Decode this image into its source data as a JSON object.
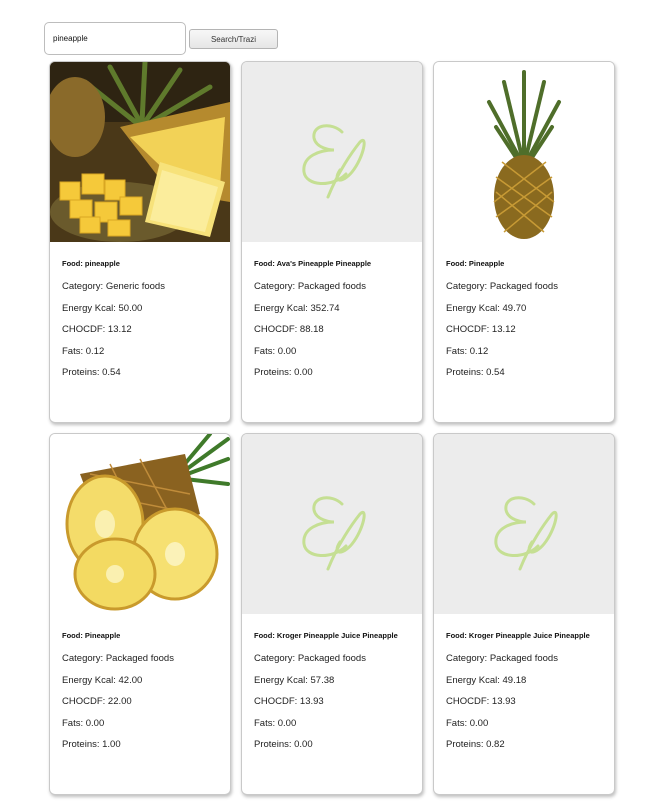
{
  "search": {
    "value": "pineapple",
    "button_label": "Search/Trazi"
  },
  "cards": [
    {
      "food": "Food: pineapple",
      "category": "Category: Generic foods",
      "energy": "Energy Kcal: 50.00",
      "chocdf": "CHOCDF: 13.12",
      "fats": "Fats: 0.12",
      "proteins": "Proteins: 0.54",
      "image": "pineapple-chunks-photo"
    },
    {
      "food": "Food: Ava's Pineapple Pineapple",
      "category": "Category: Packaged foods",
      "energy": "Energy Kcal: 352.74",
      "chocdf": "CHOCDF: 88.18",
      "fats": "Fats: 0.00",
      "proteins": "Proteins: 0.00",
      "image": "placeholder-logo"
    },
    {
      "food": "Food: Pineapple",
      "category": "Category: Packaged foods",
      "energy": "Energy Kcal: 49.70",
      "chocdf": "CHOCDF: 13.12",
      "fats": "Fats: 0.12",
      "proteins": "Proteins: 0.54",
      "image": "whole-pineapple-photo"
    },
    {
      "food": "Food: Pineapple",
      "category": "Category: Packaged foods",
      "energy": "Energy Kcal: 42.00",
      "chocdf": "CHOCDF: 22.00",
      "fats": "Fats: 0.00",
      "proteins": "Proteins: 1.00",
      "image": "pineapple-slices-photo"
    },
    {
      "food": "Food: Kroger Pineapple Juice Pineapple",
      "category": "Category: Packaged foods",
      "energy": "Energy Kcal: 57.38",
      "chocdf": "CHOCDF: 13.93",
      "fats": "Fats: 0.00",
      "proteins": "Proteins: 0.00",
      "image": "placeholder-logo"
    },
    {
      "food": "Food: Kroger Pineapple Juice Pineapple",
      "category": "Category: Packaged foods",
      "energy": "Energy Kcal: 49.18",
      "chocdf": "CHOCDF: 13.93",
      "fats": "Fats: 0.00",
      "proteins": "Proteins: 0.82",
      "image": "placeholder-logo"
    }
  ],
  "colors": {
    "placeholder_bg": "#ececec",
    "logo_green": "#c5df93",
    "card_border": "#c9c9c9"
  }
}
